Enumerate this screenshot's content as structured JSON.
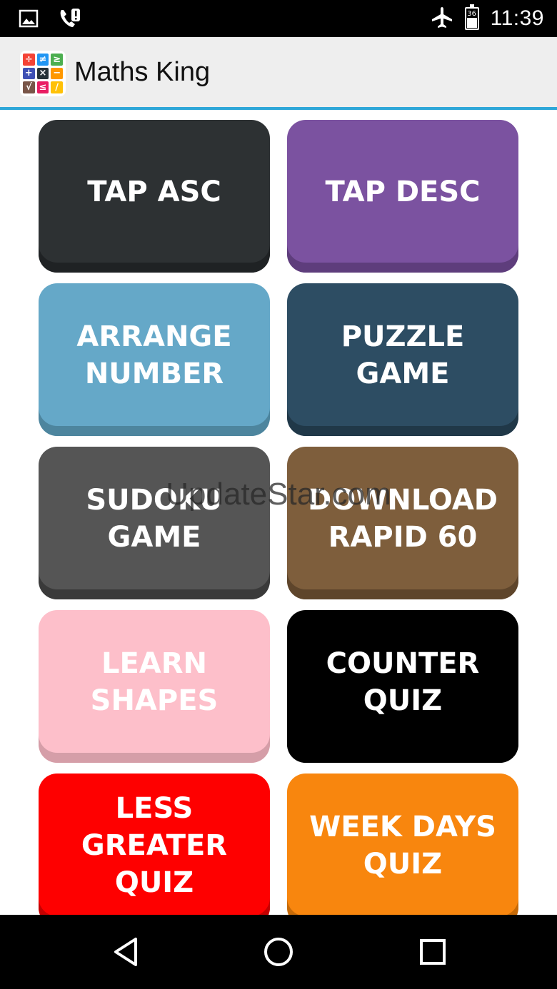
{
  "status_bar": {
    "time": "11:39",
    "battery_level": "36",
    "icons": [
      "image-icon",
      "wifi-calling-icon",
      "airplane-icon",
      "battery-icon"
    ]
  },
  "app_bar": {
    "title": "Maths King",
    "icon_cells": [
      {
        "symbol": "÷",
        "color": "#f44336"
      },
      {
        "symbol": "≠",
        "color": "#2196f3"
      },
      {
        "symbol": "≥",
        "color": "#4caf50"
      },
      {
        "symbol": "+",
        "color": "#3f51b5"
      },
      {
        "symbol": "×",
        "color": "#263238"
      },
      {
        "symbol": "−",
        "color": "#ff9800"
      },
      {
        "symbol": "√",
        "color": "#795548"
      },
      {
        "symbol": "≤",
        "color": "#e91e63"
      },
      {
        "symbol": "∕",
        "color": "#ffc107"
      }
    ],
    "accent_color": "#2ea7d8"
  },
  "menu": {
    "tiles": [
      {
        "label": "TAP ASC",
        "color": "#2d3133",
        "shadow": "#1f2224"
      },
      {
        "label": "TAP DESC",
        "color": "#7b52a0",
        "shadow": "#5e3d7c"
      },
      {
        "label": "ARRANGE\nNUMBER",
        "color": "#65a8c8",
        "shadow": "#4d859e"
      },
      {
        "label": "PUZZLE\nGAME",
        "color": "#2d4d63",
        "shadow": "#203848"
      },
      {
        "label": "SUDOKU\nGAME",
        "color": "#555555",
        "shadow": "#3a3a3a"
      },
      {
        "label": "DOWNLOAD\nRAPID 60",
        "color": "#7e5e3c",
        "shadow": "#5e452b"
      },
      {
        "label": "LEARN\nSHAPES",
        "color": "#fdbfca",
        "shadow": "#d59ea8"
      },
      {
        "label": "COUNTER\nQUIZ",
        "color": "#000000",
        "shadow": "#000000"
      },
      {
        "label": "LESS\nGREATER\nQUIZ",
        "color": "#fe0000",
        "shadow": "#c40000"
      },
      {
        "label": "WEEK DAYS\nQUIZ",
        "color": "#f8860e",
        "shadow": "#c66a08"
      }
    ]
  },
  "watermark": "UpdateStar.com",
  "nav_bar": {
    "back_label": "back",
    "home_label": "home",
    "recents_label": "recents"
  }
}
